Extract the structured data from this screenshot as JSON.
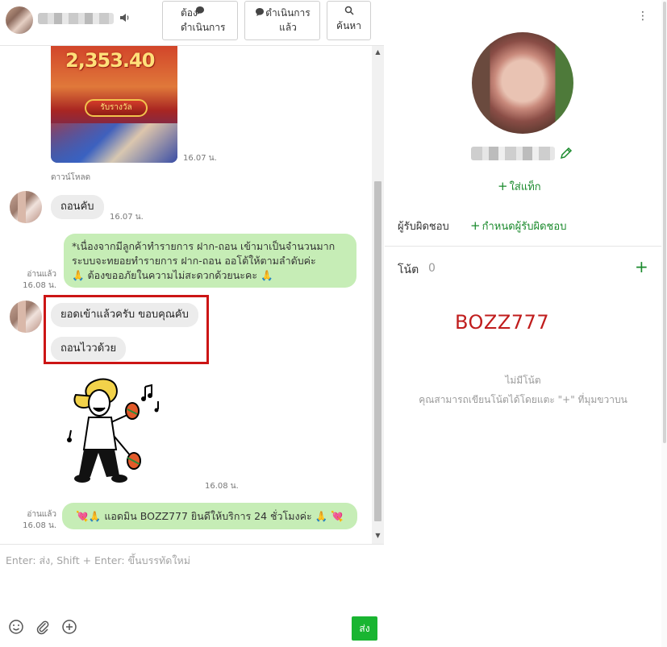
{
  "header": {
    "buttons": {
      "todo": "ต้อง\nดำเนินการ",
      "done": "ดำเนินการ\nแล้ว",
      "search": "ค้นหา"
    }
  },
  "messages": {
    "promo_amount": "2,353.40",
    "promo_badge": "รับรางวัล",
    "promo_time": "16.07 น.",
    "download_label": "ดาวน์โหลด",
    "msg1": {
      "text": "ถอนคับ",
      "time": "16.07 น."
    },
    "msg2": {
      "line1": "*เนื่องจากมีลูกค้าทำรายการ  ฝาก-ถอน เข้ามาเป็นจำนวนมาก",
      "line2": "ระบบจะทยอยทำรายการ  ฝาก-ถอน ออโต้ให้ตามลำดับค่ะ",
      "line3": "🙏 ต้องขออภัยในความไม่สะดวกด้วยนะคะ 🙏",
      "read": "อ่านแล้ว",
      "time": "16.08 น."
    },
    "msg3": {
      "text": "ยอดเข้าแล้วครับ ขอบคุณคับ"
    },
    "msg4": {
      "text": "ถอนไววด้วย"
    },
    "sticker_time": "16.08 น.",
    "msg5": {
      "text": "💘🙏  แอดมิน BOZZ777 ยินดีให้บริการ 24 ชั่วโมงค่ะ 🙏 💘",
      "read": "อ่านแล้ว",
      "time": "16.08 น."
    }
  },
  "composer": {
    "placeholder": "Enter: ส่ง, Shift + Enter: ขึ้นบรรทัดใหม่",
    "send_label": "ส่ง"
  },
  "profile": {
    "add_tag": "ใส่แท็ก",
    "assignee_label": "ผู้รับผิดชอบ",
    "assignee_action": "กำหนดผู้รับผิดชอบ",
    "notes_title": "โน้ต",
    "notes_count": "0",
    "note_text": "BOZZ777",
    "empty_title": "ไม่มีโน้ต",
    "empty_desc": "คุณสามารถเขียนโน้ตได้โดยแตะ \"+\" ที่มุมขวาบน"
  },
  "colors": {
    "accent_green": "#1a8a2c",
    "send_green": "#19b531",
    "outgoing_bubble": "#c6edb6",
    "incoming_bubble": "#ececec",
    "highlight_red": "#cc1515",
    "note_red": "#c01d1d"
  },
  "icons": [
    "mute-icon",
    "chat-bubble-icon",
    "search-icon",
    "more-vertical-icon",
    "pencil-icon",
    "plus-icon",
    "emoji-icon",
    "attach-icon",
    "add-circle-icon"
  ]
}
